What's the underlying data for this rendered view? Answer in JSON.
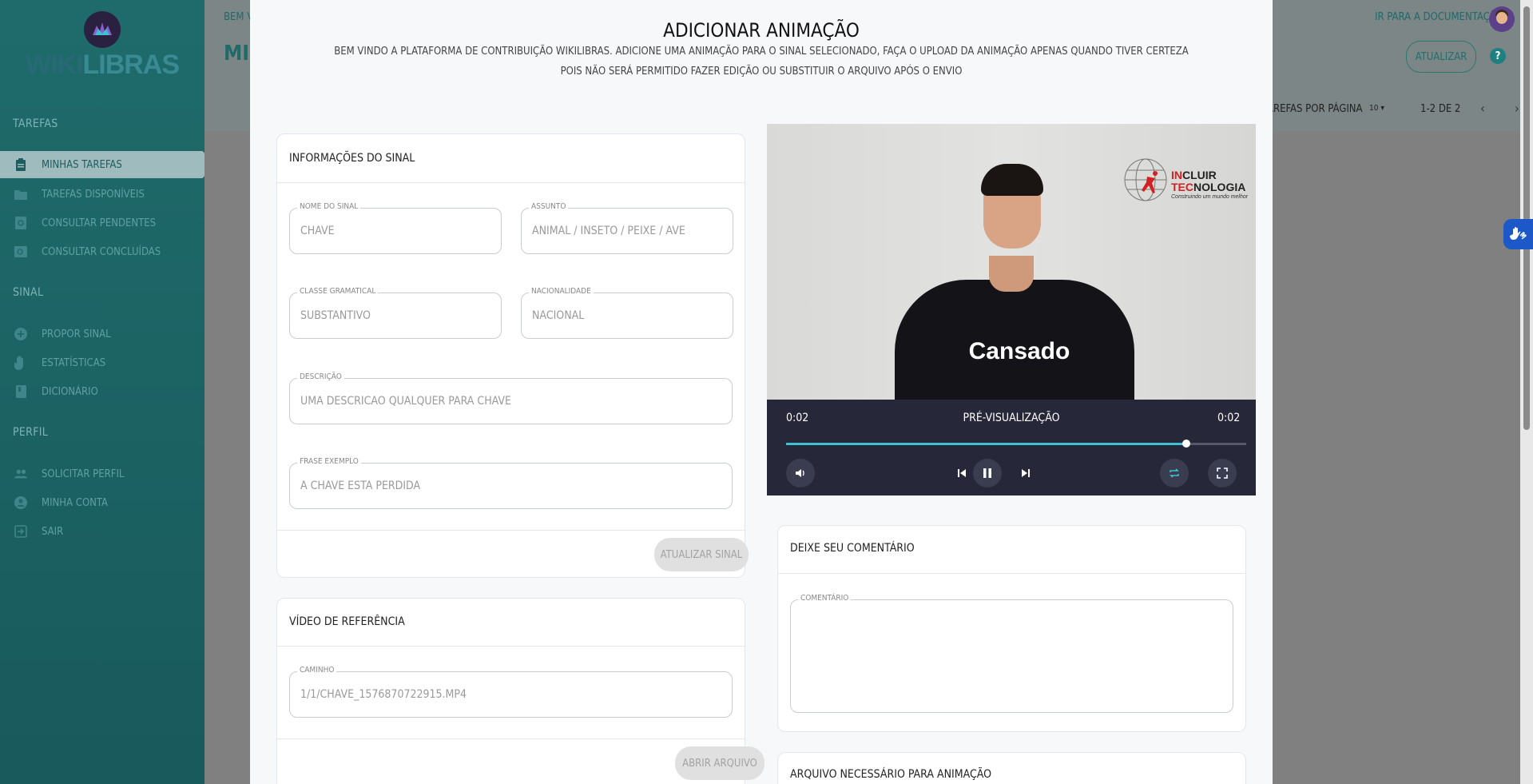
{
  "app": {
    "logo_part1": "WIKI",
    "logo_part2": "LIBRAS"
  },
  "sidebar": {
    "sections": [
      {
        "title": "Tarefas",
        "items": [
          {
            "label": "Minhas tarefas",
            "icon": "clipboard-icon",
            "active": true
          },
          {
            "label": "Tarefas disponíveis",
            "icon": "folder-icon"
          },
          {
            "label": "Consultar pendentes",
            "icon": "search-document-icon"
          },
          {
            "label": "Consultar concluídas",
            "icon": "search-image-icon"
          }
        ]
      },
      {
        "title": "Sinal",
        "items": [
          {
            "label": "Propor sinal",
            "icon": "plus-circle-icon"
          },
          {
            "label": "Estatísticas",
            "icon": "hand-icon"
          },
          {
            "label": "Dicionário",
            "icon": "book-icon"
          }
        ]
      },
      {
        "title": "Perfil",
        "items": [
          {
            "label": "Solicitar perfil",
            "icon": "people-icon"
          },
          {
            "label": "Minha conta",
            "icon": "account-circle-icon"
          },
          {
            "label": "Sair",
            "icon": "logout-icon"
          }
        ]
      }
    ]
  },
  "topbar": {
    "welcome_partial": "Bem vi",
    "title_partial": "Min",
    "docs_link": "Ir para a documentação",
    "refresh_button": "Atualizar",
    "per_page_label": "arefas por página",
    "per_page_value": "10",
    "pagination": "1-2 de 2"
  },
  "modal": {
    "title": "Adicionar Animação",
    "subtitle_line1": "Bem vindo a plataforma de contribuição WikiLibras. Adicione uma animação para o sinal selecionado, faça o upload da animação apenas quando tiver certeza",
    "subtitle_line2": "pois não será permitido fazer edição ou substituir o arquivo após o envio",
    "sign_info": {
      "title": "Informações do Sinal",
      "fields": {
        "nome": {
          "label": "Nome do sinal",
          "value": "chave"
        },
        "assunto": {
          "label": "Assunto",
          "value": "ANIMAL / INSETO / PEIXE / AVE"
        },
        "classe": {
          "label": "Classe gramatical",
          "value": "SUBSTANTIVO"
        },
        "nacionalidade": {
          "label": "Nacionalidade",
          "value": "Nacional"
        },
        "descricao": {
          "label": "Descrição",
          "value": "uma descricao qualquer para chave"
        },
        "frase": {
          "label": "Frase exemplo",
          "value": "A chave esta perdida"
        }
      },
      "update_button": "Atualizar sinal"
    },
    "ref_video": {
      "title": "Vídeo de referência",
      "path_label": "Caminho",
      "path_value": "1/1/chave_1576870722915.mp4",
      "open_button": "Abrir arquivo"
    },
    "player": {
      "caption": "Cansado",
      "logo_line1_red": "IN",
      "logo_line1_rest": "CLUIR",
      "logo_line2_red": "TEC",
      "logo_line2_rest": "NOLOGIA",
      "logo_tagline": "Construindo um mundo melhor",
      "time_current": "0:02",
      "time_total": "0:02",
      "label": "Pré-visualização",
      "progress": 0.87
    },
    "comment": {
      "title": "Deixe seu comentário",
      "field_label": "Comentário",
      "value": ""
    },
    "file_card": {
      "title": "Arquivo necessário para animação"
    }
  },
  "colors": {
    "accent": "#1e8080",
    "video_progress": "#3ec1d0",
    "sidebar": "#1f6b6b"
  }
}
